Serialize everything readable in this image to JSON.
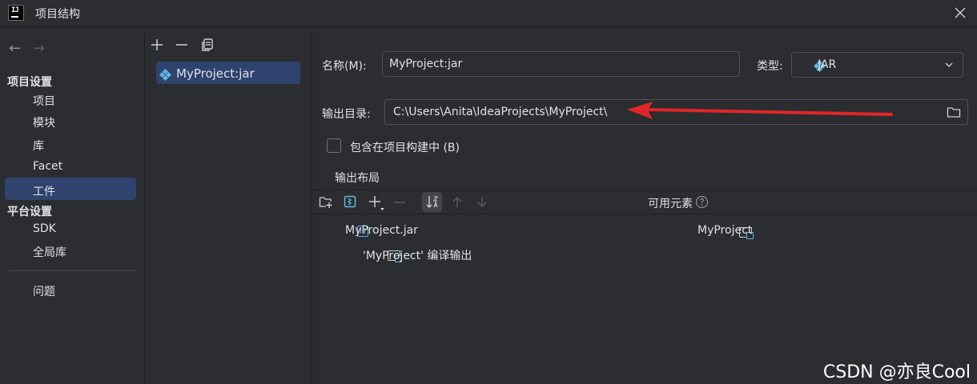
{
  "window": {
    "title": "项目结构"
  },
  "nav": {
    "back": "←",
    "forward": "→",
    "sections": [
      {
        "title": "项目设置",
        "items": [
          "项目",
          "模块",
          "库",
          "Facet",
          "工件"
        ]
      },
      {
        "title": "平台设置",
        "items": [
          "SDK",
          "全局库"
        ]
      }
    ],
    "problems": "问题",
    "selected": "工件"
  },
  "artifact_list": {
    "items": [
      "MyProject:jar"
    ]
  },
  "form": {
    "name_label": "名称(M):",
    "name_value": "MyProject:jar",
    "type_label": "类型:",
    "type_value": "JAR",
    "output_label": "输出目录:",
    "output_value": "C:\\Users\\Anita\\IdeaProjects\\MyProject\\",
    "include_label": "包含在项目构建中 (B)",
    "include_checked": false
  },
  "layout": {
    "title": "输出布局",
    "tree": [
      {
        "label": "MyProject.jar",
        "icon": "jar-icon"
      },
      {
        "label": "'MyProject' 编译输出",
        "icon": "module-folder-icon"
      }
    ],
    "available_title": "可用元素",
    "available": [
      {
        "label": "MyProject",
        "icon": "module-folder-icon"
      }
    ]
  },
  "annotation": {
    "arrow_color": "#e0262a"
  },
  "watermark": "CSDN @亦良Cool",
  "colors": {
    "selection": "#2e436e",
    "background": "#2b2d30",
    "accent": "#5fb8e6"
  }
}
